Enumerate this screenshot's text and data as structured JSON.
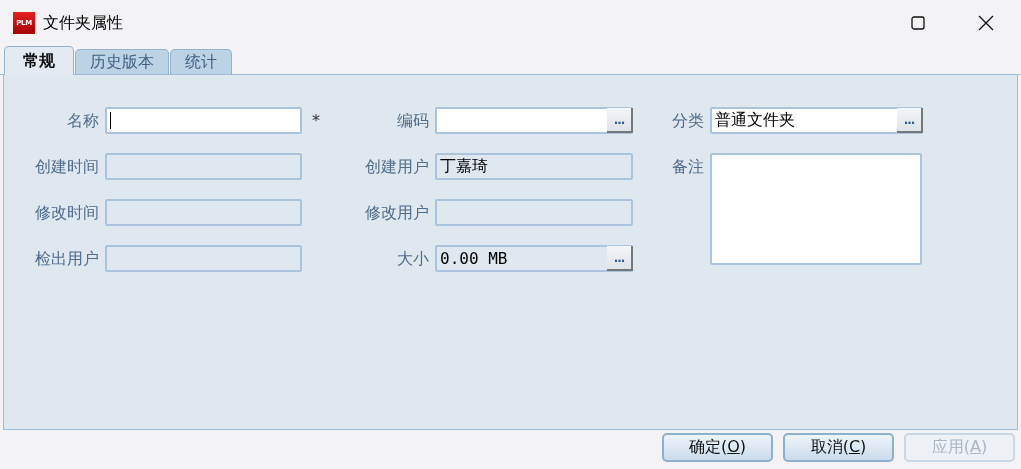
{
  "window": {
    "title": "文件夹属性",
    "icon_text": "PLM"
  },
  "tabs": [
    {
      "label": "常规",
      "selected": true
    },
    {
      "label": "历史版本",
      "selected": false
    },
    {
      "label": "统计",
      "selected": false
    }
  ],
  "columns": [
    {
      "fields": [
        {
          "label": "名称",
          "kind": "text",
          "disabled": false,
          "focused": true,
          "required_mark": "*"
        },
        {
          "label": "创建时间",
          "kind": "text",
          "disabled": true
        },
        {
          "label": "修改时间",
          "kind": "text",
          "disabled": true
        },
        {
          "label": "检出用户",
          "kind": "text",
          "disabled": true
        }
      ]
    },
    {
      "fields": [
        {
          "label": "编码",
          "kind": "lookup",
          "disabled": false,
          "button": "..."
        },
        {
          "label": "创建用户",
          "kind": "text",
          "value": "丁嘉琦",
          "disabled": true
        },
        {
          "label": "修改用户",
          "kind": "text",
          "disabled": true
        },
        {
          "label": "大小",
          "kind": "lookup",
          "value": "0.00 MB",
          "disabled": true,
          "button": "..."
        }
      ]
    },
    {
      "fields": [
        {
          "label": "分类",
          "kind": "lookup",
          "value": "普通文件夹",
          "disabled": false,
          "button": "..."
        },
        {
          "label": "备注",
          "kind": "textarea",
          "disabled": false
        }
      ]
    }
  ],
  "buttons": [
    {
      "label_before": "确定(",
      "mnemonic": "O",
      "label_after": ")",
      "disabled": false
    },
    {
      "label_before": "取消(",
      "mnemonic": "C",
      "label_after": ")",
      "disabled": false
    },
    {
      "label_before": "应用(",
      "mnemonic": "A",
      "label_after": ")",
      "disabled": true
    }
  ]
}
